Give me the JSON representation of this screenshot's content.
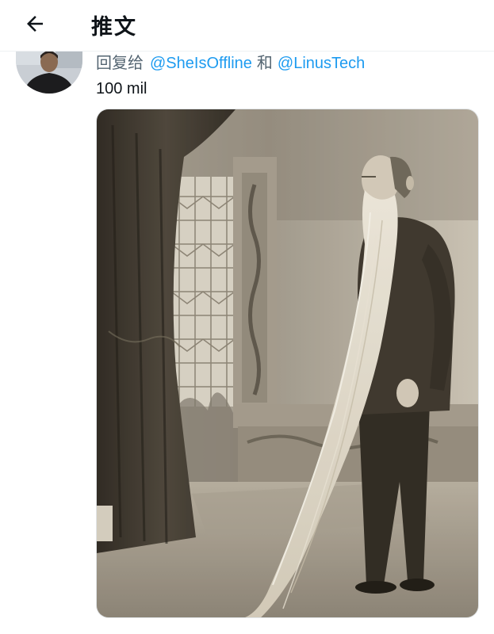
{
  "header": {
    "back_icon": "arrow-left-icon",
    "title": "推文"
  },
  "tweet": {
    "reply_prefix": "回复给",
    "reply_handles": [
      "@SheIsOffline",
      "@LinusTech"
    ],
    "reply_conjunction": "和",
    "text": "100 mil",
    "avatar_icon": "user-avatar",
    "media_description_icon": "sepia-photo"
  },
  "colors": {
    "text": "#0f1419",
    "secondary": "#536471",
    "link": "#1d9bf0",
    "sepia_light": "#e9e2d4",
    "sepia_dark": "#2c2720"
  }
}
